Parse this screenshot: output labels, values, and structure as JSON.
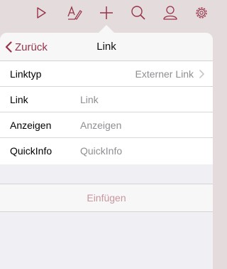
{
  "toolbar": {
    "icons": [
      "play-icon",
      "text-format-icon",
      "plus-icon",
      "search-icon",
      "person-icon",
      "gear-icon"
    ],
    "accent": "#98334a"
  },
  "nav": {
    "back_label": "Zurück",
    "title": "Link"
  },
  "rows": {
    "linktyp": {
      "label": "Linktyp",
      "value": "Externer Link"
    },
    "link": {
      "label": "Link",
      "placeholder": "Link"
    },
    "anzeigen": {
      "label": "Anzeigen",
      "placeholder": "Anzeigen"
    },
    "quickinfo": {
      "label": "QuickInfo",
      "placeholder": "QuickInfo"
    }
  },
  "insert_label": "Einfügen",
  "colors": {
    "accent": "#98334a",
    "disabled": "#c896a0",
    "backdrop": "#e4dcdc"
  }
}
